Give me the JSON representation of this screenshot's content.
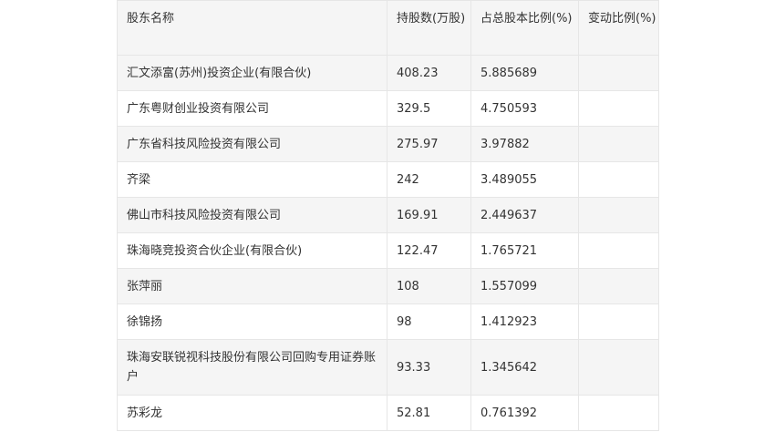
{
  "table": {
    "headers": [
      "股东名称",
      "持股数(万股)",
      "占总股本比例(%)",
      "变动比例(%)"
    ],
    "rows": [
      [
        "汇文添富(苏州)投资企业(有限合伙)",
        "408.23",
        "5.885689",
        ""
      ],
      [
        "广东粤财创业投资有限公司",
        "329.5",
        "4.750593",
        ""
      ],
      [
        "广东省科技风险投资有限公司",
        "275.97",
        "3.97882",
        ""
      ],
      [
        "齐梁",
        "242",
        "3.489055",
        ""
      ],
      [
        "佛山市科技风险投资有限公司",
        "169.91",
        "2.449637",
        ""
      ],
      [
        "珠海晓竞投资合伙企业(有限合伙)",
        "122.47",
        "1.765721",
        ""
      ],
      [
        "张萍丽",
        "108",
        "1.557099",
        ""
      ],
      [
        "徐锦扬",
        "98",
        "1.412923",
        ""
      ],
      [
        "珠海安联锐视科技股份有限公司回购专用证券账户",
        "93.33",
        "1.345642",
        ""
      ],
      [
        "苏彩龙",
        "52.81",
        "0.761392",
        ""
      ]
    ]
  }
}
